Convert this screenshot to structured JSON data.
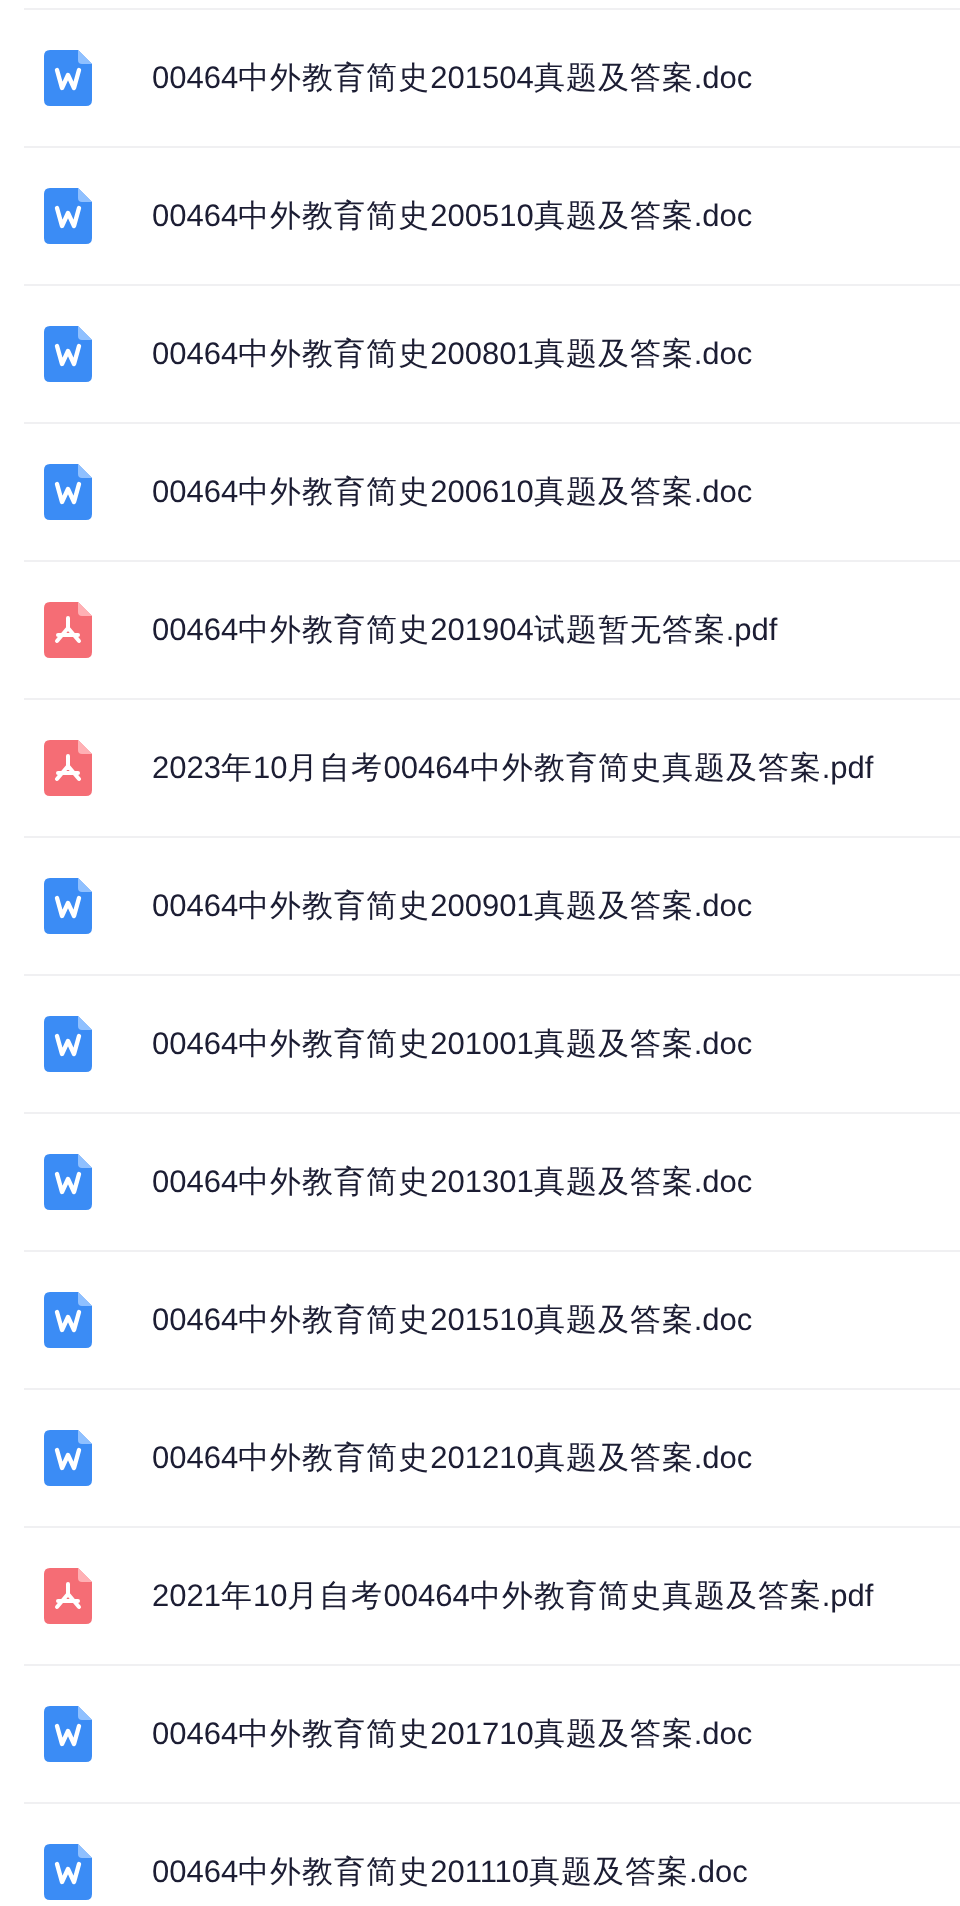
{
  "files": [
    {
      "kind": "doc",
      "name": "00464中外教育简史201504真题及答案.doc"
    },
    {
      "kind": "doc",
      "name": "00464中外教育简史200510真题及答案.doc"
    },
    {
      "kind": "doc",
      "name": "00464中外教育简史200801真题及答案.doc"
    },
    {
      "kind": "doc",
      "name": "00464中外教育简史200610真题及答案.doc"
    },
    {
      "kind": "pdf",
      "name": "00464中外教育简史201904试题暂无答案.pdf"
    },
    {
      "kind": "pdf",
      "name": "2023年10月自考00464中外教育简史真题及答案.pdf"
    },
    {
      "kind": "doc",
      "name": "00464中外教育简史200901真题及答案.doc"
    },
    {
      "kind": "doc",
      "name": "00464中外教育简史201001真题及答案.doc"
    },
    {
      "kind": "doc",
      "name": "00464中外教育简史201301真题及答案.doc"
    },
    {
      "kind": "doc",
      "name": "00464中外教育简史201510真题及答案.doc"
    },
    {
      "kind": "doc",
      "name": "00464中外教育简史201210真题及答案.doc"
    },
    {
      "kind": "pdf",
      "name": "2021年10月自考00464中外教育简史真题及答案.pdf"
    },
    {
      "kind": "doc",
      "name": "00464中外教育简史201710真题及答案.doc"
    },
    {
      "kind": "doc",
      "name": "00464中外教育简史201110真题及答案.doc"
    }
  ]
}
